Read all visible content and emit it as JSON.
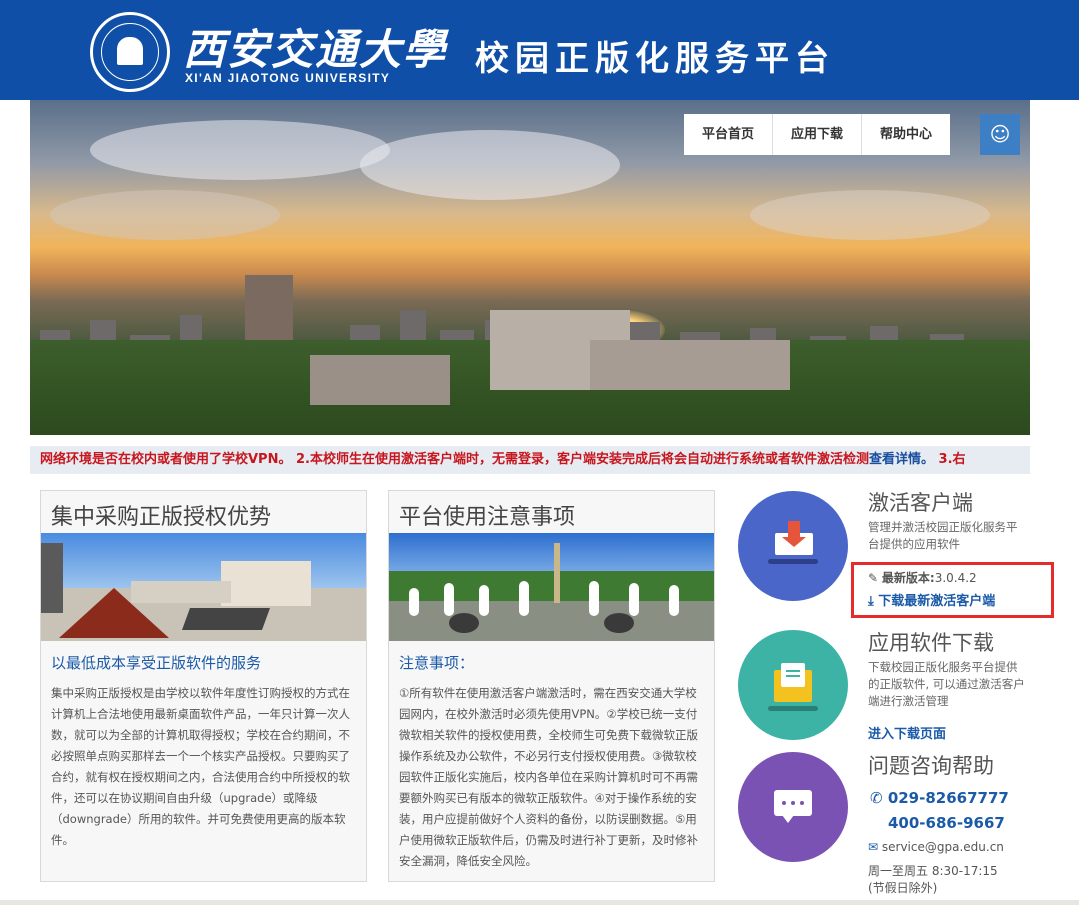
{
  "header": {
    "logo_cn": "西安交通大學",
    "logo_en": "XI'AN JIAOTONG UNIVERSITY",
    "title": "校园正版化服务平台"
  },
  "nav": {
    "items": [
      "平台首页",
      "应用下载",
      "帮助中心"
    ],
    "icon": "smiley-icon"
  },
  "marquee": {
    "text": "网络环境是否在校内或者使用了学校VPN。 2.本校师生在使用激活客户端时，无需登录，客户端安装完成后将会自动进行系统或者软件激活检测",
    "link": "查看详情。",
    "tail": " 3.右"
  },
  "cards": [
    {
      "title": "集中采购正版授权优势",
      "subtitle": "以最低成本享受正版软件的服务",
      "text": "集中采购正版授权是由学校以软件年度性订购授权的方式在计算机上合法地使用最新桌面软件产品，一年只计算一次人数，就可以为全部的计算机取得授权；学校在合约期间，不必按照单点购买那样去一个一个核实产品授权。只要购买了合约，就有权在授权期间之内，合法使用合约中所授权的软件，还可以在协议期间自由升级（upgrade）或降级（downgrade）所用的软件。并可免费使用更高的版本软件。"
    },
    {
      "title": "平台使用注意事项",
      "subtitle": "注意事项：",
      "text": "①所有软件在使用激活客户端激活时，需在西安交通大学校园网内，在校外激活时必须先使用VPN。②学校已统一支付微软相关软件的授权使用费，全校师生可免费下载微软正版操作系统及办公软件，不必另行支付授权使用费。③微软校园软件正版化实施后，校内各单位在采购计算机时可不再需要额外购买已有版本的微软正版软件。④对于操作系统的安装，用户应提前做好个人资料的备份，以防误删数据。⑤用户使用微软正版软件后，仍需及时进行补丁更新，及时修补安全漏洞，降低安全风险。"
    }
  ],
  "right": {
    "activation": {
      "title": "激活客户端",
      "desc": "管理并激活校园正版化服务平台提供的应用软件",
      "version_label": "最新版本:",
      "version": "3.0.4.2",
      "download_link": "下载最新激活客户端"
    },
    "software": {
      "title": "应用软件下载",
      "desc": "下载校园正版化服务平台提供的正版软件, 可以通过激活客户端进行激活管理",
      "link": "进入下载页面"
    },
    "help": {
      "title": "问题咨询帮助",
      "phone1": "029-82667777",
      "phone2": "400-686-9667",
      "email": "service@gpa.edu.cn",
      "hours": "周一至周五 8:30-17:15",
      "holiday": "(节假日除外)"
    }
  },
  "colors": {
    "header_blue": "#0f4fa8",
    "link_blue": "#1a5aa8",
    "alert_red": "#c7161d",
    "highlight_red": "#e52b2b",
    "circle_blue": "#4a66c8",
    "circle_teal": "#3db3a6",
    "circle_purple": "#7a52b3"
  }
}
